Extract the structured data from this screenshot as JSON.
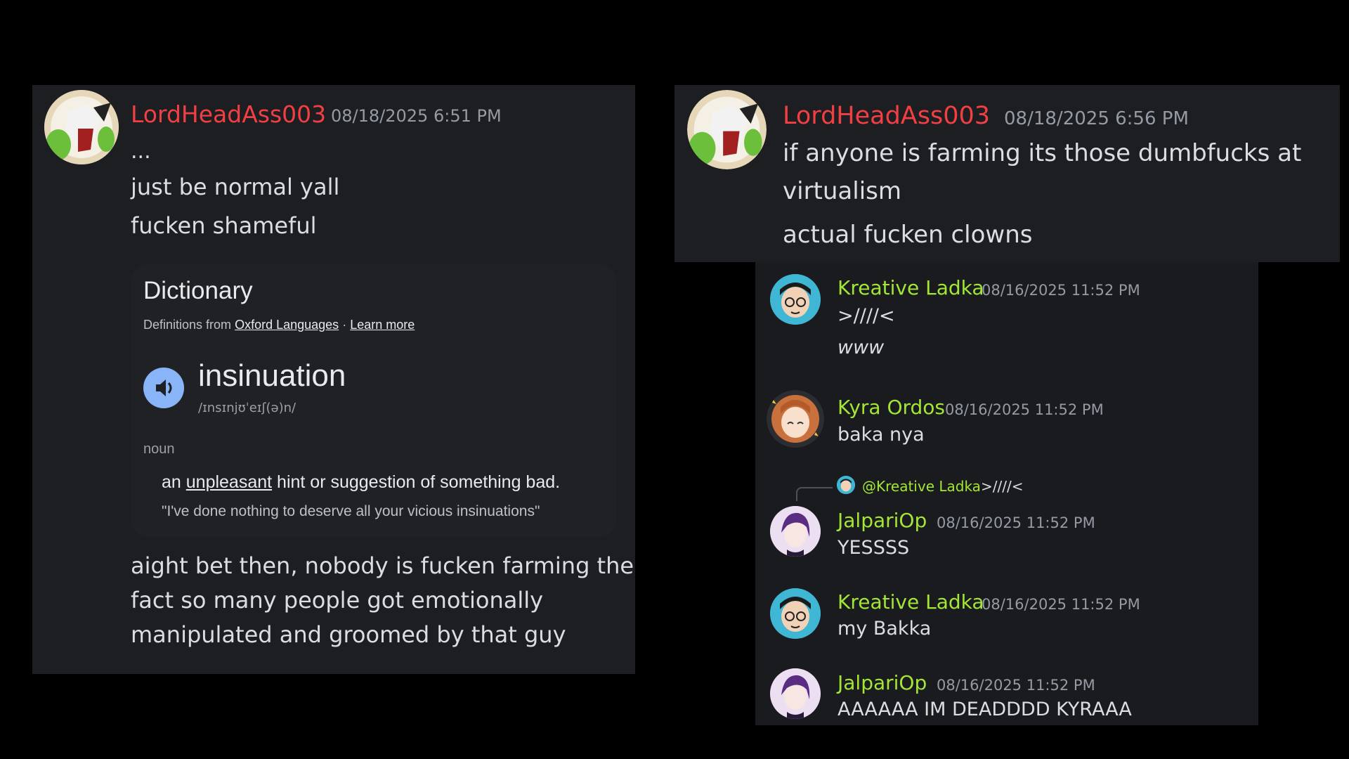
{
  "colors": {
    "background": "#000000",
    "panel": "#1e1f22",
    "username_red": "#f23f43",
    "username_green": "#a3e635",
    "timestamp": "#949ba4",
    "text": "#dbdee1",
    "dict_card": "#202124",
    "dict_speaker": "#8ab4f8"
  },
  "left_message": {
    "username": "LordHeadAss003",
    "timestamp": "08/18/2025 6:51 PM",
    "lines": [
      "...",
      "just be normal yall",
      "fucken shameful"
    ],
    "after_lines": [
      "aight bet then, nobody is fucken farming the",
      "fact so many people got emotionally",
      "manipulated and groomed by that guy"
    ],
    "avatar_icon": "anime-character-avatar-icon"
  },
  "dictionary": {
    "title": "Dictionary",
    "source_prefix": "Definitions from",
    "source_link": "Oxford Languages",
    "separator": "·",
    "learn_more": "Learn more",
    "word": "insinuation",
    "phonetic": "/ɪnsɪnjʊˈeɪʃ(ə)n/",
    "part_of_speech": "noun",
    "definition_pre": "an",
    "definition_link": "unpleasant",
    "definition_post": "hint or suggestion of something bad.",
    "example": "\"I've done nothing to deserve all your vicious insinuations\"",
    "speaker_icon": "speaker-icon"
  },
  "right_top_message": {
    "username": "LordHeadAss003",
    "timestamp": "08/18/2025 6:56 PM",
    "lines": [
      "if anyone is farming its those dumbfucks at",
      "virtualism",
      "actual fucken clowns"
    ]
  },
  "right_bottom_messages": [
    {
      "username": "Kreative Ladka",
      "timestamp": "08/16/2025 11:52 PM",
      "lines": [
        ">////<",
        "www"
      ],
      "avatar_icon": "glasses-boy-avatar-icon"
    },
    {
      "username": "Kyra Ordos",
      "timestamp": "08/16/2025 11:52 PM",
      "lines": [
        "baka nya"
      ],
      "avatar_icon": "orange-hair-girl-avatar-icon"
    },
    {
      "reply_to": "@Kreative Ladka",
      "reply_text": ">////<",
      "username": "JalpariOp",
      "timestamp": "08/16/2025 11:52 PM",
      "lines": [
        "YESSSS"
      ],
      "avatar_icon": "purple-hair-girl-avatar-icon"
    },
    {
      "username": "Kreative Ladka",
      "timestamp": "08/16/2025 11:52 PM",
      "lines": [
        "my Bakka"
      ],
      "avatar_icon": "glasses-boy-avatar-icon"
    },
    {
      "username": "JalpariOp",
      "timestamp": "08/16/2025 11:52 PM",
      "lines": [
        "AAAAAA IM DEADDDD KYRAAA"
      ],
      "avatar_icon": "purple-hair-girl-avatar-icon"
    }
  ]
}
